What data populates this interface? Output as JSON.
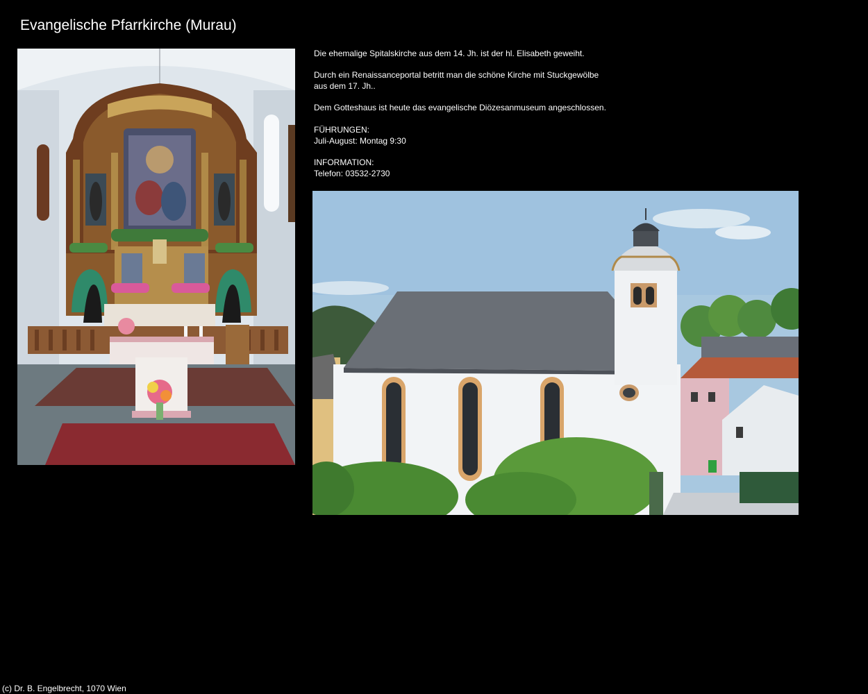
{
  "page": {
    "title": "Evangelische Pfarrkirche (Murau)",
    "background": "#000000",
    "text_color": "#ffffff"
  },
  "description": {
    "paragraph1": "Die ehemalige Spitalskirche aus dem 14. Jh. ist der hl. Elisabeth geweiht.",
    "paragraph2_line1": "Durch ein Renaissanceportal betritt man die schöne Kirche mit Stuckgewölbe",
    "paragraph2_line2": "aus dem 17. Jh..",
    "paragraph3": "Dem Gotteshaus ist heute das evangelische Diözesanmuseum angeschlossen.",
    "tours_heading": "FÜHRUNGEN:",
    "tours_text": "Juli-August: Montag 9:30",
    "info_heading": "INFORMATION:",
    "info_text": "Telefon: 03532-2730"
  },
  "images": {
    "interior": "photo of church interior with altar",
    "exterior": "photo of church exterior with tower"
  },
  "footer": {
    "copyright": "(c) Dr. B. Engelbrecht, 1070 Wien"
  }
}
